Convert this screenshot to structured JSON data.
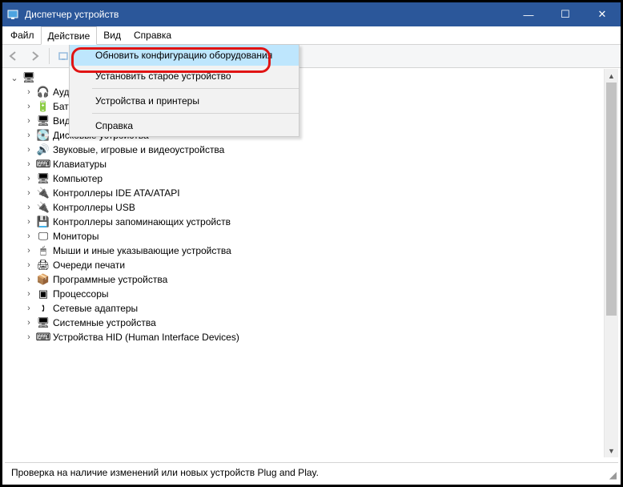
{
  "window": {
    "title": "Диспетчер устройств",
    "min": "—",
    "max": "☐",
    "close": "✕"
  },
  "menubar": {
    "file": "Файл",
    "action": "Действие",
    "view": "Вид",
    "help": "Справка"
  },
  "dropdown": {
    "update": "Обновить конфигурацию оборудования",
    "legacy": "Установить старое устройство",
    "devprint": "Устройства и принтеры",
    "help": "Справка"
  },
  "tree": {
    "root": "",
    "items": [
      {
        "icon": "🎧",
        "label": "Аудиовходы и аудиовыходы"
      },
      {
        "icon": "🔋",
        "label": "Батареи"
      },
      {
        "icon": "🖥",
        "label": "Видеоадаптеры"
      },
      {
        "icon": "💽",
        "label": "Дисковые устройства"
      },
      {
        "icon": "🔊",
        "label": "Звуковые, игровые и видеоустройства"
      },
      {
        "icon": "⌨",
        "label": "Клавиатуры"
      },
      {
        "icon": "🖥",
        "label": "Компьютер"
      },
      {
        "icon": "🔌",
        "label": "Контроллеры IDE ATA/ATAPI"
      },
      {
        "icon": "🔌",
        "label": "Контроллеры USB"
      },
      {
        "icon": "💾",
        "label": "Контроллеры запоминающих устройств"
      },
      {
        "icon": "🖵",
        "label": "Мониторы"
      },
      {
        "icon": "🖱",
        "label": "Мыши и иные указывающие устройства"
      },
      {
        "icon": "🖨",
        "label": "Очереди печати"
      },
      {
        "icon": "📦",
        "label": "Программные устройства"
      },
      {
        "icon": "▣",
        "label": "Процессоры"
      },
      {
        "icon": "🕽",
        "label": "Сетевые адаптеры"
      },
      {
        "icon": "🖥",
        "label": "Системные устройства"
      },
      {
        "icon": "⌨",
        "label": "Устройства HID (Human Interface Devices)"
      }
    ]
  },
  "statusbar": {
    "text": "Проверка на наличие изменений или новых устройств Plug and Play."
  }
}
